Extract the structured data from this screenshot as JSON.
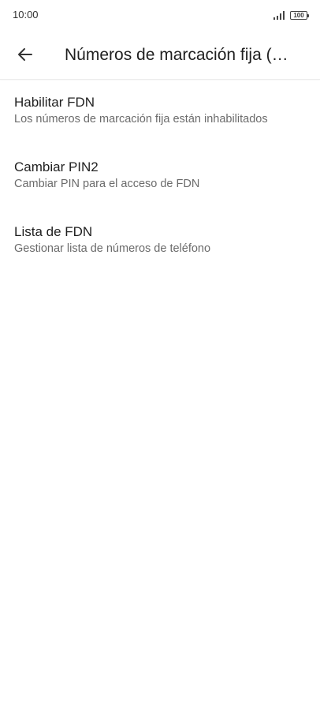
{
  "status_bar": {
    "time": "10:00",
    "battery_level": "100",
    "signal_icon": "signal-bars-icon",
    "battery_icon": "battery-icon"
  },
  "app_bar": {
    "back_icon": "arrow-left-icon",
    "title": "Números de marcación fija (SIM)"
  },
  "settings": {
    "items": [
      {
        "title": "Habilitar FDN",
        "summary": "Los números de marcación fija están inhabilitados"
      },
      {
        "title": "Cambiar PIN2",
        "summary": "Cambiar PIN para el acceso de FDN"
      },
      {
        "title": "Lista de FDN",
        "summary": "Gestionar lista de números de teléfono"
      }
    ]
  },
  "colors": {
    "background": "#ffffff",
    "primary_text": "#1f1f1f",
    "secondary_text": "#6b6b6b",
    "divider": "#ececec"
  }
}
